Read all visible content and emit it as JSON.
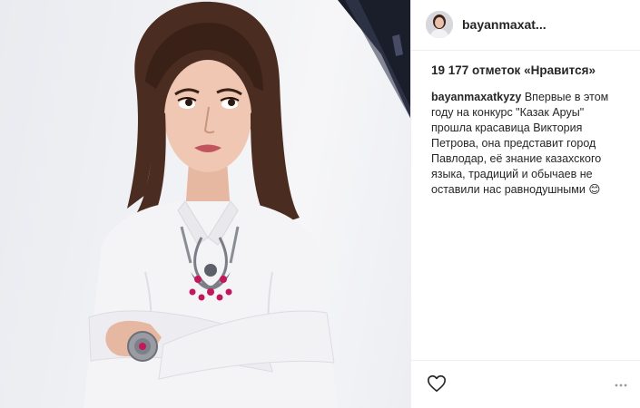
{
  "post": {
    "username": "bayanmaxat...",
    "likes_text": "19 177 отметок «Нравится»",
    "caption_user": "bayanmaxatkyzy",
    "caption_text": " Впервые в этом году на конкурс \"Казак Аруы\" прошла красавица Виктория Петрова, она представит город Павлодар, её знание казахского языка, традиций и обычаев не оставили нас равнодушными",
    "caption_emoji": "😊"
  },
  "icons": {
    "like": "heart-icon",
    "options": "more-options-icon"
  },
  "colors": {
    "text": "#262626",
    "divider": "#efefef",
    "necklace_bead": "#c2185b"
  }
}
